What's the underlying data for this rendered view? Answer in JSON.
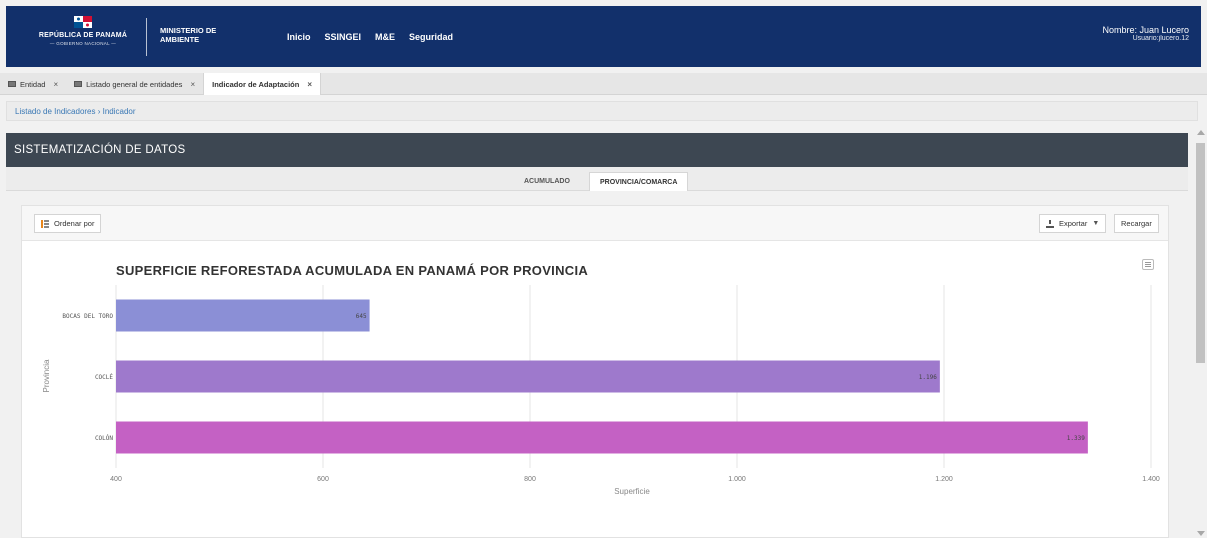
{
  "header": {
    "logo_title": "REPÚBLICA DE PANAMÁ",
    "logo_subtitle": "— GOBIERNO NACIONAL —",
    "ministry_line1": "MINISTERIO DE",
    "ministry_line2": "AMBIENTE",
    "nav": [
      "Inicio",
      "SSINGEI",
      "M&E",
      "Seguridad"
    ],
    "user_name": "Nombre: Juan Lucero",
    "user_login": "Usuario:jlucero.12"
  },
  "tabs": [
    {
      "label": "Entidad",
      "active": false,
      "icon": true
    },
    {
      "label": "Listado general de entidades",
      "active": false,
      "icon": true
    },
    {
      "label": "Indicador de Adaptación",
      "active": true,
      "icon": false
    }
  ],
  "tab_close": "×",
  "breadcrumb": "Listado de Indicadores › Indicador",
  "panel_title": "SISTEMATIZACIÓN DE DATOS",
  "subtabs": {
    "acumulado": "ACUMULADO",
    "provincia": "PROVINCIA/COMARCA"
  },
  "toolbar": {
    "order_label": "Ordenar por",
    "export_label": "Exportar",
    "reload_label": "Recargar"
  },
  "colors": {
    "header_bg": "#12306b",
    "panel_header_bg": "#3d4752",
    "bar1": "#8b8fd6",
    "bar2": "#9e79cc",
    "bar3": "#c461c4"
  },
  "chart_data": {
    "type": "bar",
    "orientation": "horizontal",
    "title": "SUPERFICIE REFORESTADA ACUMULADA EN PANAMÁ POR PROVINCIA",
    "xlabel": "Superficie",
    "ylabel": "Provincia",
    "categories": [
      "BOCAS DEL TORO",
      "COCLÉ",
      "COLÓN"
    ],
    "values": [
      645,
      1196,
      1339
    ],
    "value_labels": [
      "645",
      "1.196",
      "1.339"
    ],
    "xlim": [
      400,
      1400
    ],
    "xticks": [
      400,
      600,
      800,
      1000,
      1200,
      1400
    ],
    "xtick_labels": [
      "400",
      "600",
      "800",
      "1.000",
      "1.200",
      "1.400"
    ],
    "grid": true,
    "legend": "none"
  }
}
